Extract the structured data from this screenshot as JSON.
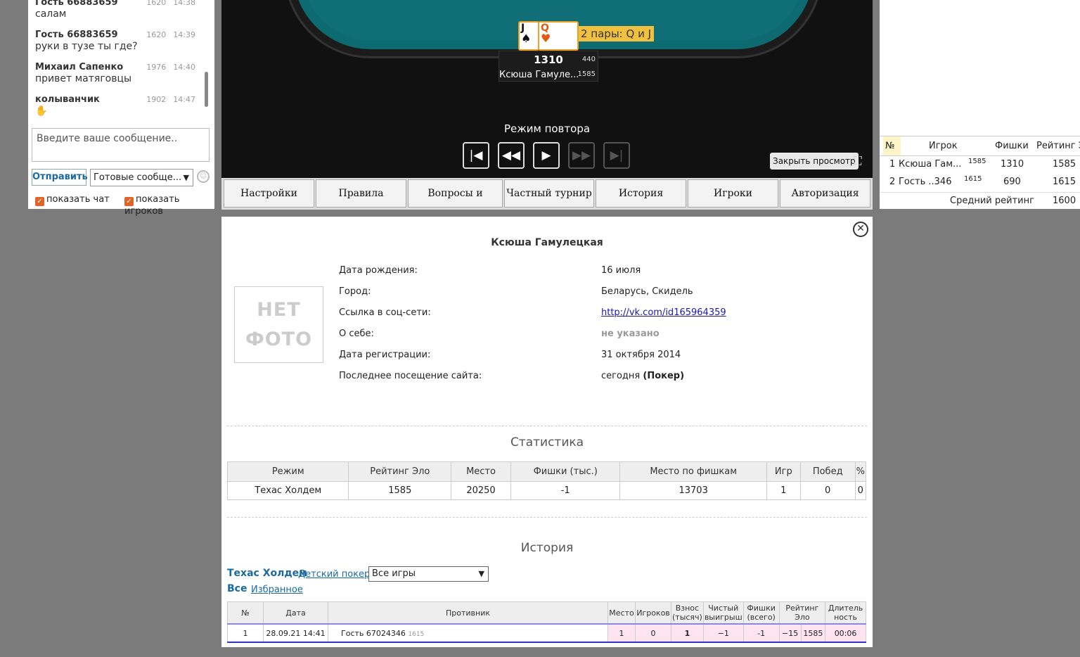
{
  "chat": {
    "messages": [
      {
        "author": "Гость 66883659",
        "rating": "1620",
        "time": "14:38",
        "text": "салам"
      },
      {
        "author": "Гость 66883659",
        "rating": "1620",
        "time": "14:39",
        "text": "руки в тузе ты где?"
      },
      {
        "author": "Михаил Сапенко",
        "rating": "1976",
        "time": "14:40",
        "text": "привет матяговцы"
      },
      {
        "author": "колыванчик",
        "rating": "1902",
        "time": "14:47",
        "text": "✋"
      }
    ],
    "input_placeholder": "Введите ваше сообщение..",
    "send_label": "Отправить",
    "ready_select": "Готовые сообще...",
    "show_chat": "показать чат",
    "show_players": "показать игроков"
  },
  "table": {
    "cards": [
      {
        "rank": "J",
        "suit": "♠",
        "color": "#111111"
      },
      {
        "rank": "Q",
        "suit": "♥",
        "color": "#e05a10"
      }
    ],
    "hand_label": "2 пары: Q и J",
    "seat": {
      "chips": "1310",
      "bet": "440",
      "name": "Ксюша Гамуле...",
      "rating": "1585"
    },
    "replay_title": "Режим повтора",
    "close_view": "Закрыть просмотр"
  },
  "nav": [
    "Настройки",
    "Правила",
    "Вопросы и отзывы",
    "Частный турнир",
    "История",
    "Игроки",
    "Авторизация"
  ],
  "players": {
    "headers": {
      "no": "№",
      "player": "Игрок",
      "chips": "Фишки",
      "rating": "Рейтинг Э"
    },
    "rows": [
      {
        "no": "1",
        "name": "Ксюша Гам...",
        "sup": "1585",
        "chips": "1310",
        "rating": "1585"
      },
      {
        "no": "2",
        "name": "Гость ..346",
        "sup": "1615",
        "chips": "690",
        "rating": "1615"
      }
    ],
    "avg_label": "Средний рейтинг",
    "avg_value": "1600"
  },
  "profile": {
    "name": "Ксюша Гамулецкая",
    "no_photo": "НЕТ ФОТО",
    "fields": [
      {
        "label": "Дата рождения:",
        "value": "16 июля"
      },
      {
        "label": "Город:",
        "value": "Беларусь, Скидель"
      },
      {
        "label": "Ссылка в соц-сети:",
        "value": "http://vk.com/id165964359"
      },
      {
        "label": "О себе:",
        "value": "не указано"
      },
      {
        "label": "Дата регистрации:",
        "value": "31 октября 2014"
      },
      {
        "label": "Последнее посещение сайта:",
        "value": "сегодня",
        "value_bold": "(Покер)"
      }
    ],
    "stats_title": "Статистика",
    "stats_headers": [
      "Режим",
      "Рейтинг Эло",
      "Место",
      "Фишки (тыс.)",
      "Место по фишкам",
      "Игр",
      "Побед",
      "%"
    ],
    "stats_row": [
      "Техас Холдем",
      "1585",
      "20250",
      "-1",
      "13703",
      "1",
      "0",
      "0"
    ],
    "history_title": "История",
    "tab_texas": "Техас Холдем",
    "tab_kids": "Детский покер",
    "games_select": "Все игры",
    "tab_all": "Все",
    "tab_fav": "Избранное",
    "history_headers": [
      "№",
      "Дата",
      "Противник",
      "Место",
      "Игроков",
      "Взнос (тысяч)",
      "Чистый выигрыш",
      "Фишки (всего)",
      "Рейтинг Эло",
      "Длитель ность"
    ],
    "history_row": {
      "no": "1",
      "date": "28.09.21  14:41",
      "opponent": "Гость 67024346",
      "opp_rating": "1615",
      "place": "1",
      "players": "0",
      "fee": "1",
      "net": "−1",
      "chips": "-1",
      "elo_delta": "−15",
      "elo": "1585",
      "duration": "00:06"
    }
  }
}
